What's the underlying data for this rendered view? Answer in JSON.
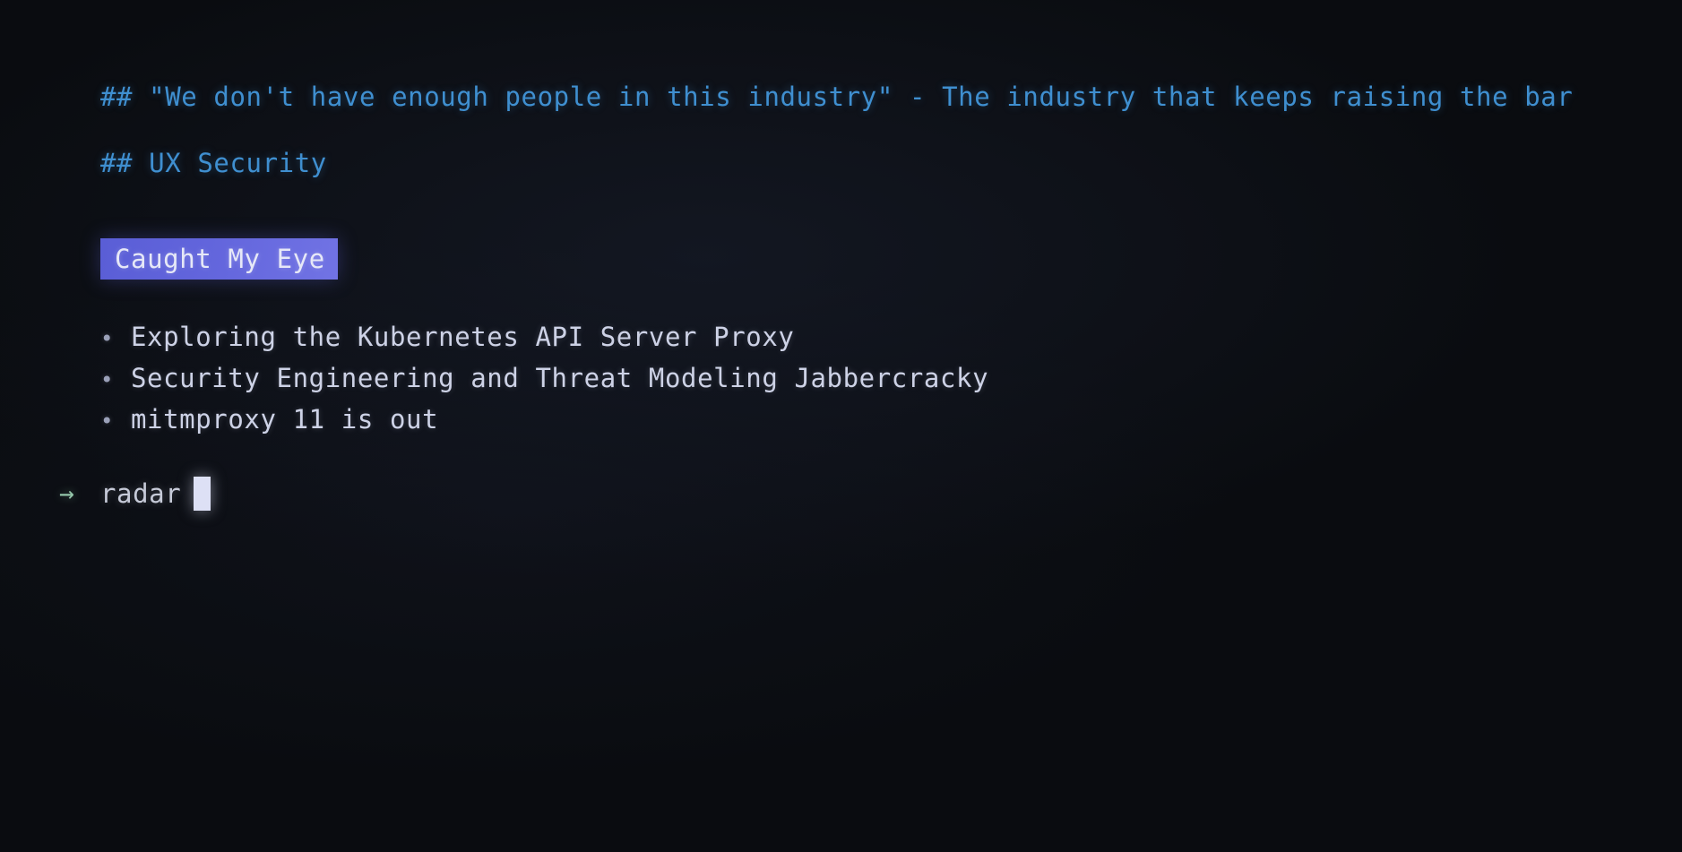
{
  "terminal": {
    "background_color": "#0a0c10",
    "heading_color": "#3f8fd0",
    "body_text_color": "#cdd2e6",
    "bullet_marker_color": "#9aa0b8",
    "banner_background_color": "#6265dc",
    "banner_text_color": "#e6e8f7",
    "prompt_arrow_color": "#93c5a9",
    "cursor_color": "#dde0f5"
  },
  "headings": [
    {
      "id": "heading-industry",
      "text": "## \"We don't have enough people in this industry\" - The industry that keeps raising the bar"
    },
    {
      "id": "heading-ux-security",
      "text": "## UX Security"
    }
  ],
  "banner": {
    "label": "Caught My Eye"
  },
  "bullets": {
    "marker": "•",
    "items": [
      {
        "text": "Exploring the Kubernetes API Server Proxy"
      },
      {
        "text": "Security Engineering and Threat Modeling Jabbercracky"
      },
      {
        "text": "mitmproxy 11 is out"
      }
    ]
  },
  "prompt": {
    "symbol": "→",
    "command": "radar",
    "cursor": ""
  }
}
